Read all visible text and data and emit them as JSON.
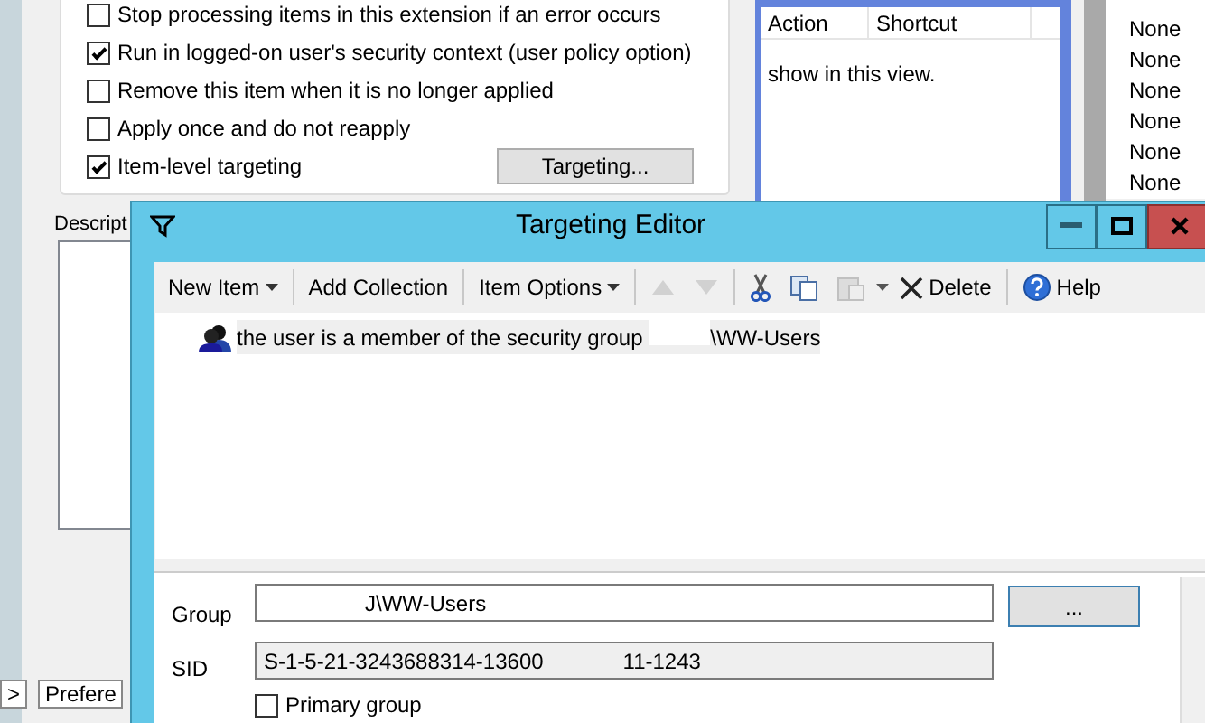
{
  "properties_dialog": {
    "options": [
      {
        "label": "Stop processing items in this extension if an error occurs",
        "checked": false
      },
      {
        "label": "Run in logged-on user's security context (user policy option)",
        "checked": true
      },
      {
        "label": "Remove this item when it is no longer applied",
        "checked": false
      },
      {
        "label": "Apply once and do not reapply",
        "checked": false
      },
      {
        "label": "Item-level targeting",
        "checked": true
      }
    ],
    "targeting_button": "Targeting...",
    "description_label": "Descript",
    "tabs": [
      {
        "label": ">"
      },
      {
        "label": "Prefere"
      }
    ]
  },
  "shortcut_panel": {
    "columns": [
      "Action",
      "Shortcut"
    ],
    "empty_text": "show in this view.",
    "values": [
      "None",
      "None",
      "None",
      "None",
      "None",
      "None"
    ]
  },
  "targeting_editor": {
    "title": "Targeting Editor",
    "toolbar": [
      {
        "kind": "menu",
        "label": "New Item"
      },
      {
        "kind": "sep"
      },
      {
        "kind": "text",
        "label": "Add Collection"
      },
      {
        "kind": "sep"
      },
      {
        "kind": "menu",
        "label": "Item Options"
      },
      {
        "kind": "sep"
      },
      {
        "kind": "up",
        "disabled": true
      },
      {
        "kind": "down",
        "disabled": true
      },
      {
        "kind": "sep"
      },
      {
        "kind": "cut",
        "disabled": false
      },
      {
        "kind": "copy",
        "disabled": false
      },
      {
        "kind": "paste",
        "disabled": true
      },
      {
        "kind": "dropdown"
      },
      {
        "kind": "delete",
        "label": "Delete"
      },
      {
        "kind": "sep"
      },
      {
        "kind": "help",
        "label": "Help"
      }
    ],
    "items": [
      {
        "text": "the user is a member of the security group",
        "group": "\\WW-Users",
        "selected": true
      }
    ],
    "group_label": "Group",
    "group_value": "J\\WW-Users",
    "browse_button": "...",
    "sid_label": "SID",
    "sid_value_start": "S-1-5-21-3243688314-13600",
    "sid_value_end": "11-1243",
    "primary_group": {
      "label": "Primary group",
      "checked": false
    }
  }
}
